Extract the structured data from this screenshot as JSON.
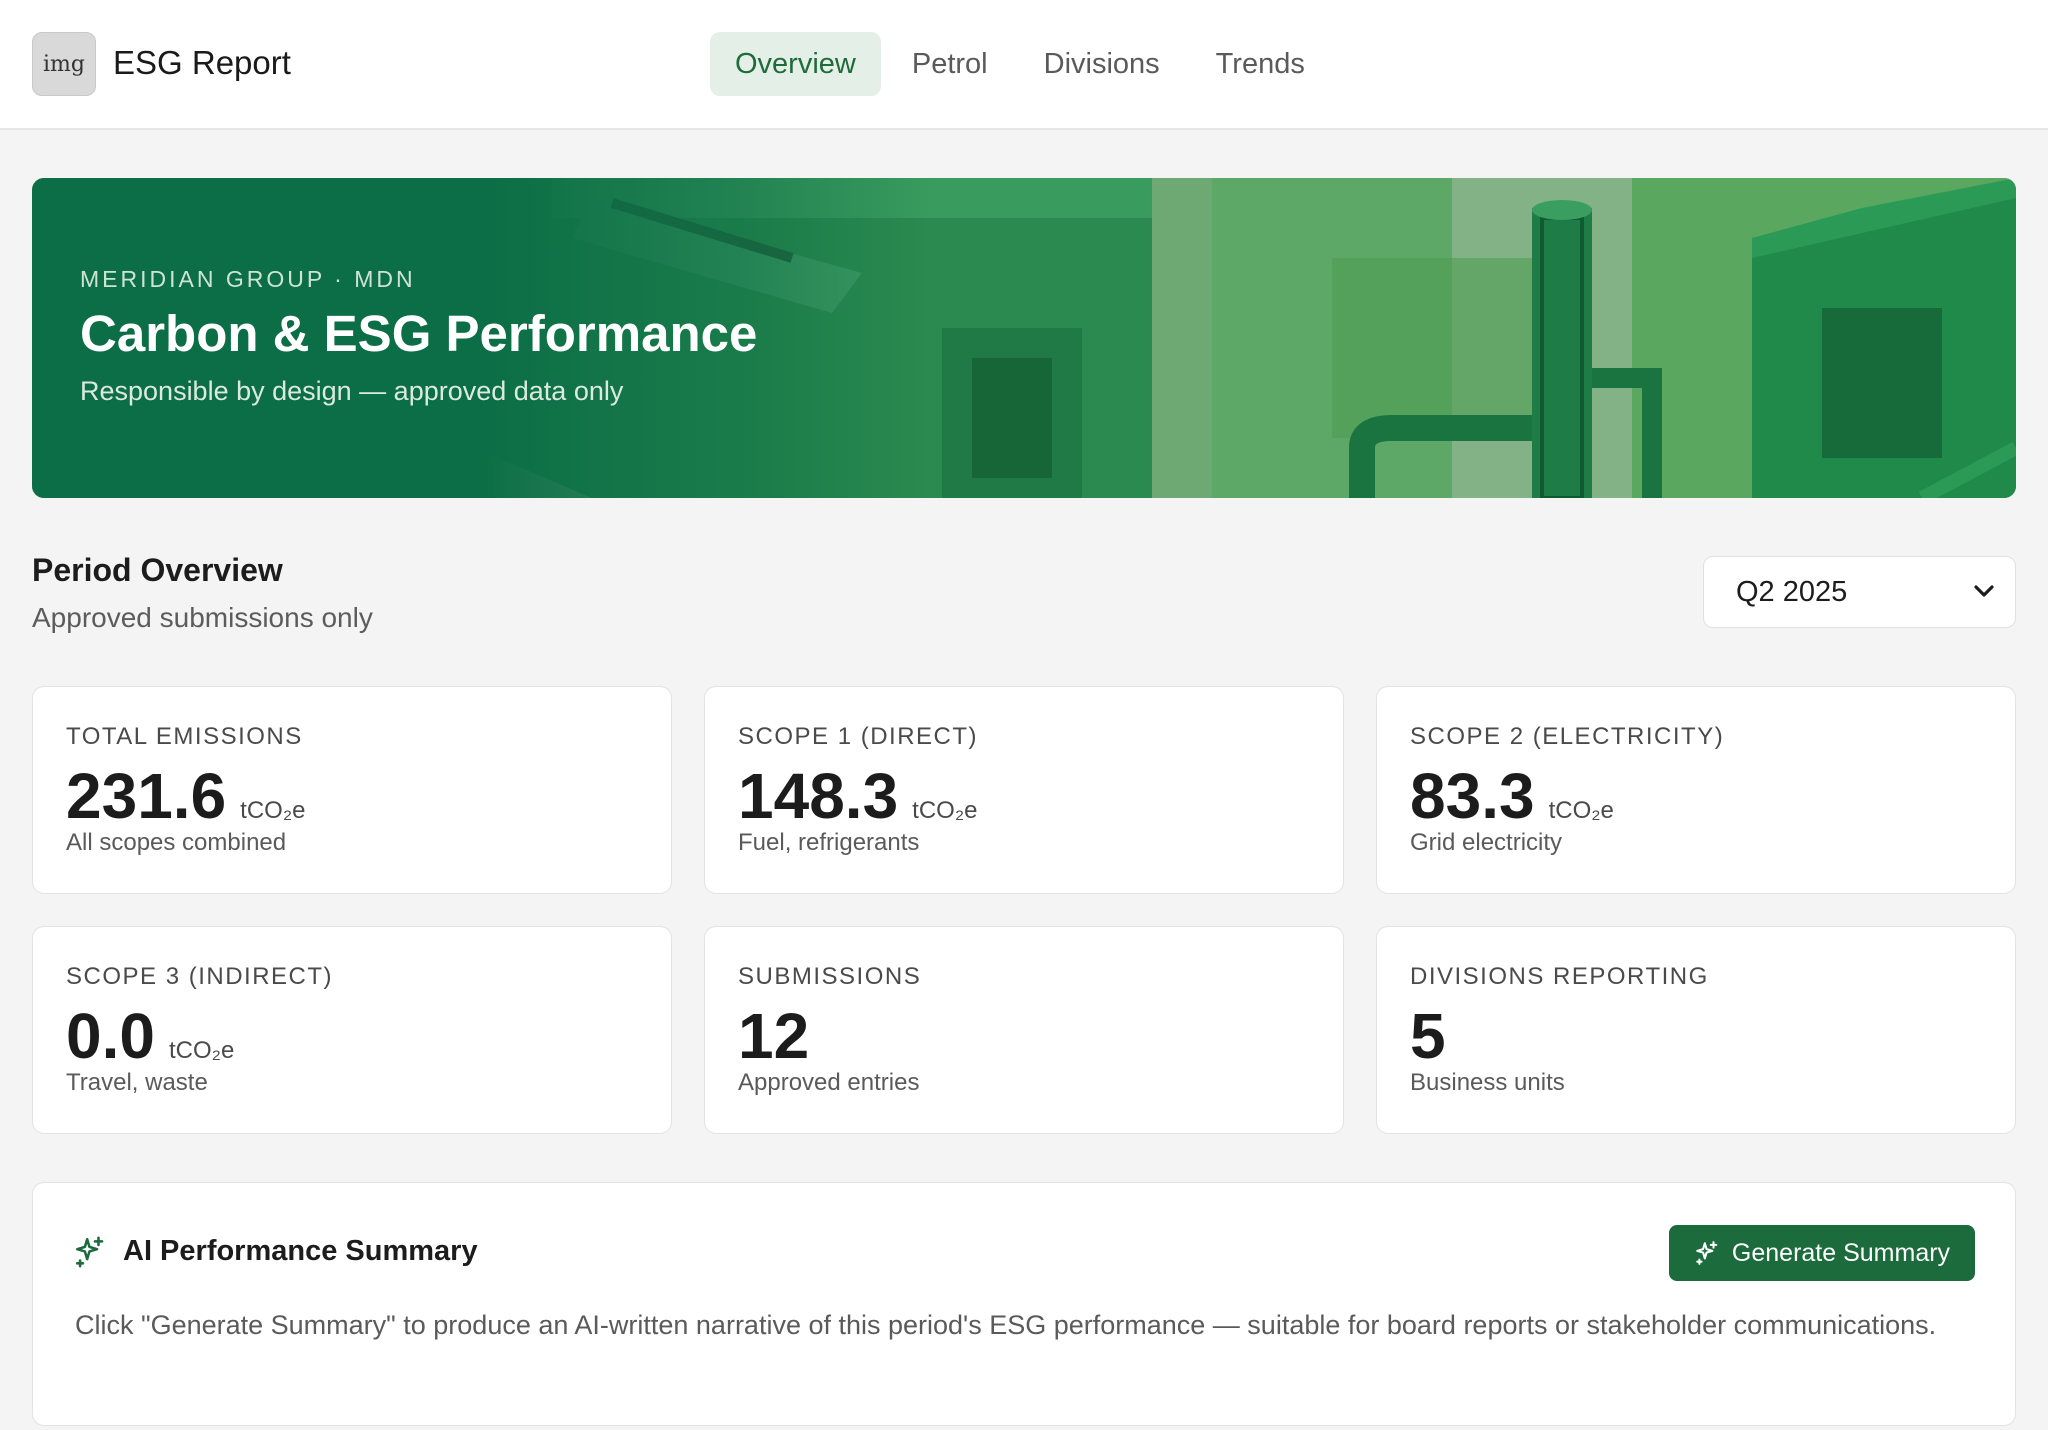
{
  "header": {
    "logo_text": "img",
    "app_title": "ESG Report",
    "tabs": [
      {
        "label": "Overview",
        "active": true
      },
      {
        "label": "Petrol",
        "active": false
      },
      {
        "label": "Divisions",
        "active": false
      },
      {
        "label": "Trends",
        "active": false
      }
    ]
  },
  "hero": {
    "eyebrow": "MERIDIAN GROUP · MDN",
    "title": "Carbon & ESG Performance",
    "subtitle": "Responsible by design — approved data only"
  },
  "period": {
    "title": "Period Overview",
    "subtitle": "Approved submissions only",
    "selected": "Q2 2025"
  },
  "cards": [
    {
      "label": "TOTAL EMISSIONS",
      "value": "231.6",
      "unit": "tCO₂e",
      "note": "All scopes combined"
    },
    {
      "label": "SCOPE 1 (DIRECT)",
      "value": "148.3",
      "unit": "tCO₂e",
      "note": "Fuel, refrigerants"
    },
    {
      "label": "SCOPE 2 (ELECTRICITY)",
      "value": "83.3",
      "unit": "tCO₂e",
      "note": "Grid electricity"
    },
    {
      "label": "SCOPE 3 (INDIRECT)",
      "value": "0.0",
      "unit": "tCO₂e",
      "note": "Travel, waste"
    },
    {
      "label": "SUBMISSIONS",
      "value": "12",
      "unit": "",
      "note": "Approved entries"
    },
    {
      "label": "DIVISIONS REPORTING",
      "value": "5",
      "unit": "",
      "note": "Business units"
    }
  ],
  "ai_summary": {
    "title": "AI Performance Summary",
    "button_label": "Generate Summary",
    "text": "Click \"Generate Summary\" to produce an AI-written narrative of this period's ESG performance — suitable for board reports or stakeholder communications."
  },
  "colors": {
    "accent": "#1b6b3c",
    "hero_green": "#0c6e46",
    "tab_active_bg": "#e4efe7"
  },
  "icons": {
    "period_select": "chevron-down-icon",
    "ai": "sparkles-icon"
  }
}
